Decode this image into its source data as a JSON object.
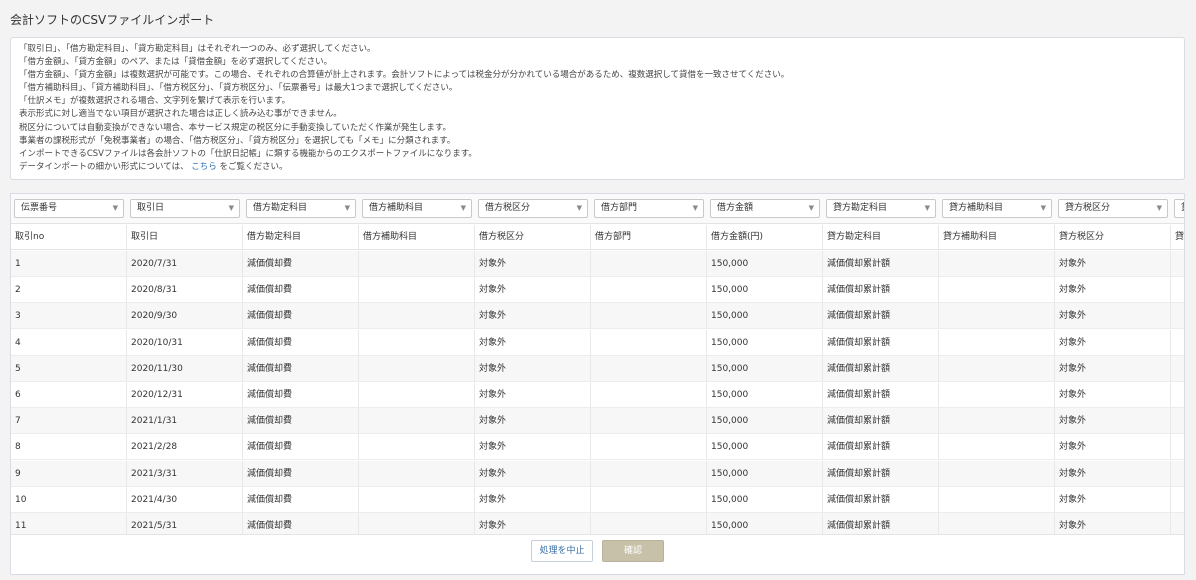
{
  "page": {
    "title": "会計ソフトのCSVファイルインポート"
  },
  "notice": {
    "lines": [
      "「取引日」、「借方勘定科目」、「貸方勘定科目」はそれぞれ一つのみ、必ず選択してください。",
      "「借方金額」、「貸方金額」のペア、または「貸借金額」を必ず選択してください。",
      "「借方金額」、「貸方金額」は複数選択が可能です。この場合、それぞれの合算値が計上されます。会計ソフトによっては税金分が分かれている場合があるため、複数選択して貸借を一致させてください。",
      "「借方補助科目」、「貸方補助科目」、「借方税区分」、「貸方税区分」、「伝票番号」は最大1つまで選択してください。",
      "「仕訳メモ」が複数選択される場合、文字列を繋げて表示を行います。",
      "表示形式に対し適当でない項目が選択された場合は正しく読み込む事ができません。",
      "税区分については自動変換ができない場合、本サービス規定の税区分に手動変換していただく作業が発生します。",
      "事業者の課税形式が「免税事業者」の場合、「借方税区分」、「貸方税区分」を選択しても「メモ」に分類されます。",
      "インポートできるCSVファイルは各会計ソフトの「仕訳日記帳」に類する機能からのエクスポートファイルになります。"
    ],
    "last_prefix": "データインポートの細かい形式については、",
    "link_text": "こちら",
    "last_suffix": "をご覧ください。"
  },
  "selects": [
    "伝票番号",
    "取引日",
    "借方勘定科目",
    "借方補助科目",
    "借方税区分",
    "借方部門",
    "借方金額",
    "貸方勘定科目",
    "貸方補助科目",
    "貸方税区分",
    "貸"
  ],
  "headers": [
    "取引no",
    "取引日",
    "借方勘定科目",
    "借方補助科目",
    "借方税区分",
    "借方部門",
    "借方金額(円)",
    "貸方勘定科目",
    "貸方補助科目",
    "貸方税区分",
    "貸"
  ],
  "rows": [
    [
      "1",
      "2020/7/31",
      "減価償却費",
      "",
      "対象外",
      "",
      "150,000",
      "減価償却累計額",
      "",
      "対象外",
      ""
    ],
    [
      "2",
      "2020/8/31",
      "減価償却費",
      "",
      "対象外",
      "",
      "150,000",
      "減価償却累計額",
      "",
      "対象外",
      ""
    ],
    [
      "3",
      "2020/9/30",
      "減価償却費",
      "",
      "対象外",
      "",
      "150,000",
      "減価償却累計額",
      "",
      "対象外",
      ""
    ],
    [
      "4",
      "2020/10/31",
      "減価償却費",
      "",
      "対象外",
      "",
      "150,000",
      "減価償却累計額",
      "",
      "対象外",
      ""
    ],
    [
      "5",
      "2020/11/30",
      "減価償却費",
      "",
      "対象外",
      "",
      "150,000",
      "減価償却累計額",
      "",
      "対象外",
      ""
    ],
    [
      "6",
      "2020/12/31",
      "減価償却費",
      "",
      "対象外",
      "",
      "150,000",
      "減価償却累計額",
      "",
      "対象外",
      ""
    ],
    [
      "7",
      "2021/1/31",
      "減価償却費",
      "",
      "対象外",
      "",
      "150,000",
      "減価償却累計額",
      "",
      "対象外",
      ""
    ],
    [
      "8",
      "2021/2/28",
      "減価償却費",
      "",
      "対象外",
      "",
      "150,000",
      "減価償却累計額",
      "",
      "対象外",
      ""
    ],
    [
      "9",
      "2021/3/31",
      "減価償却費",
      "",
      "対象外",
      "",
      "150,000",
      "減価償却累計額",
      "",
      "対象外",
      ""
    ],
    [
      "10",
      "2021/4/30",
      "減価償却費",
      "",
      "対象外",
      "",
      "150,000",
      "減価償却累計額",
      "",
      "対象外",
      ""
    ],
    [
      "11",
      "2021/5/31",
      "減価償却費",
      "",
      "対象外",
      "",
      "150,000",
      "減価償却累計額",
      "",
      "対象外",
      ""
    ]
  ],
  "buttons": {
    "cancel": "処理を中止",
    "confirm": "確認"
  },
  "icons": {
    "select_arrow": "▼"
  }
}
